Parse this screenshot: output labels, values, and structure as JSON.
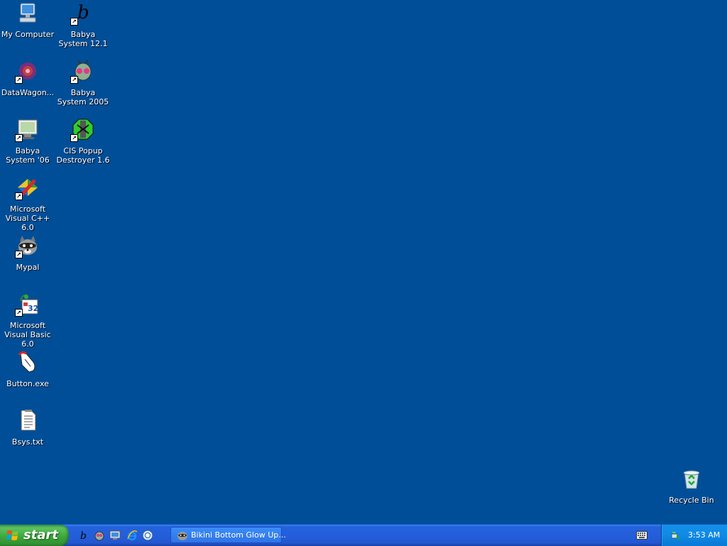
{
  "desktop": {
    "icons": [
      {
        "label": "My Computer",
        "icon": "my-computer-icon"
      },
      {
        "label": "Babya System 12.1",
        "icon": "babya-b-logo-icon"
      },
      {
        "label": "DataWagon...",
        "icon": "datawagon-icon"
      },
      {
        "label": "Babya System 2005",
        "icon": "alien-robot-icon"
      },
      {
        "label": "Babya System '06",
        "icon": "monitor-icon"
      },
      {
        "label": "CIS Popup Destroyer 1.6",
        "icon": "popup-destroyer-icon"
      },
      {
        "label": "Microsoft Visual C++ 6.0",
        "icon": "visual-cpp-icon"
      },
      {
        "label": "Mypal",
        "icon": "raccoon-icon"
      },
      {
        "label": "Microsoft Visual Basic 6.0",
        "icon": "visual-basic-icon"
      },
      {
        "label": "Button.exe",
        "icon": "hand-pointer-icon"
      },
      {
        "label": "Bsys.txt",
        "icon": "text-file-icon"
      },
      {
        "label": "Recycle Bin",
        "icon": "recycle-bin-icon"
      }
    ]
  },
  "taskbar": {
    "start_label": "start",
    "quick_launch": [
      "babya-b-logo-icon",
      "alien-robot-icon",
      "show-desktop-icon",
      "internet-explorer-icon",
      "browser-icon"
    ],
    "task_button_label": "Bikini Bottom Glow Up...",
    "clock": "3:53 AM"
  },
  "colors": {
    "desktop": "#004e98",
    "taskbar": "#245edb",
    "start": "#3aa53a",
    "tray": "#0f8ae5"
  }
}
